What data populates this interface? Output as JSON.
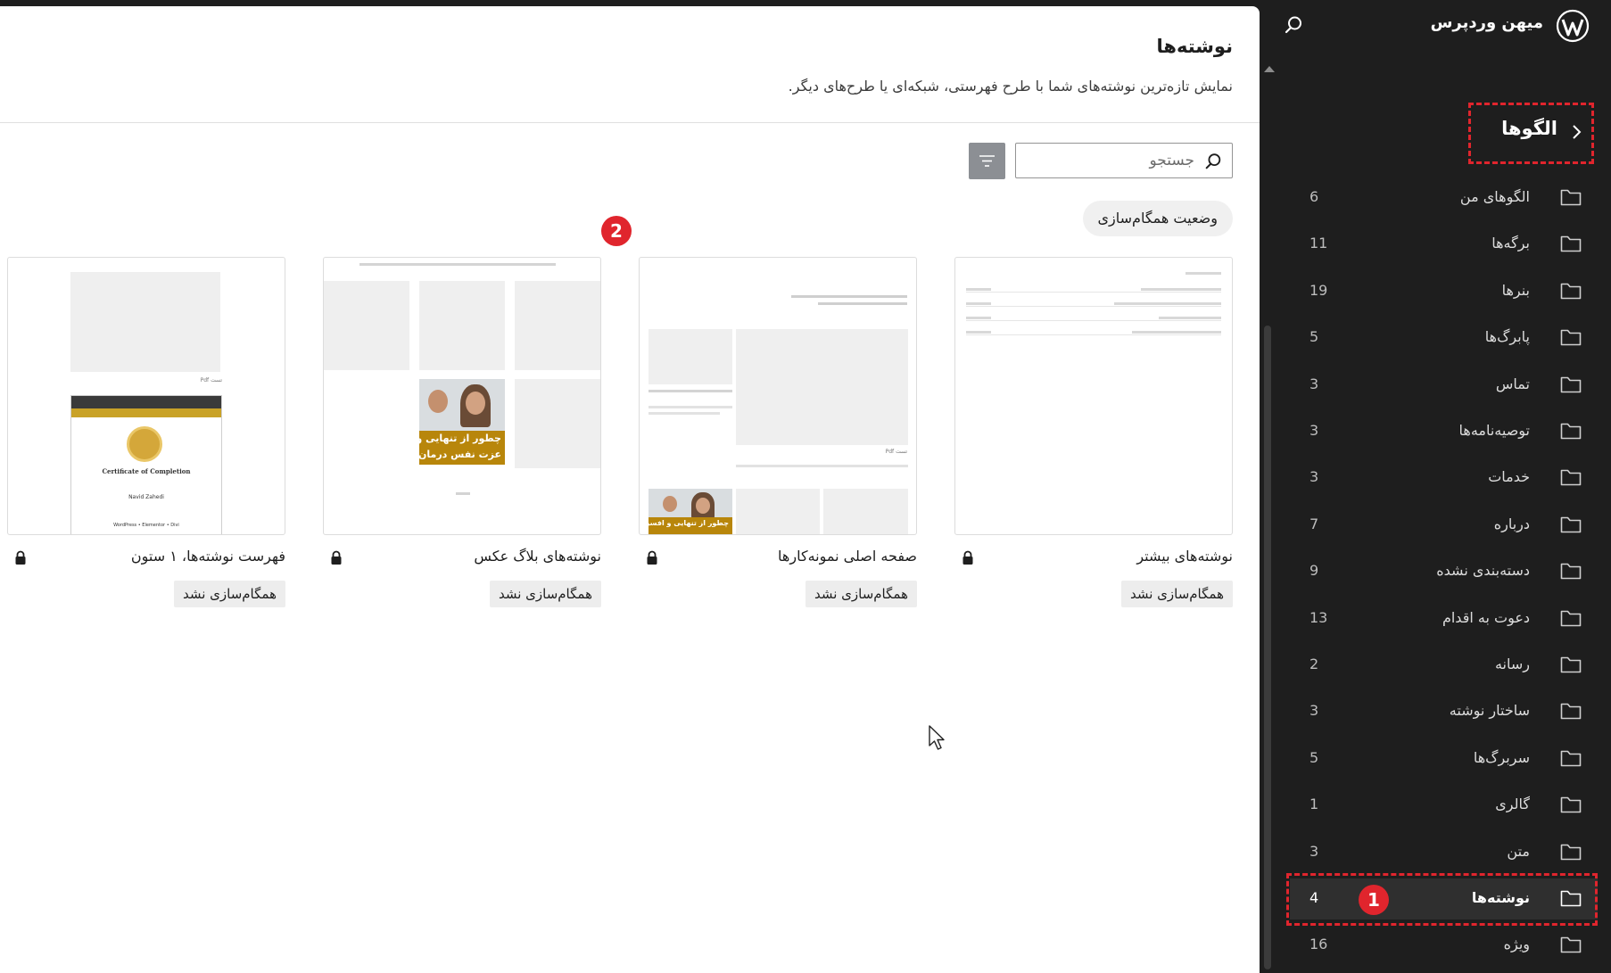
{
  "sidebar": {
    "site_name": "میهن وردپرس",
    "back_label": "الگوها",
    "categories": [
      {
        "name": "الگوهای من",
        "count": "6"
      },
      {
        "name": "برگه‌ها",
        "count": "11"
      },
      {
        "name": "بنرها",
        "count": "19"
      },
      {
        "name": "پابرگ‌ها",
        "count": "5"
      },
      {
        "name": "تماس",
        "count": "3"
      },
      {
        "name": "توصیه‌نامه‌ها",
        "count": "3"
      },
      {
        "name": "خدمات",
        "count": "3"
      },
      {
        "name": "درباره",
        "count": "7"
      },
      {
        "name": "دسته‌بندی نشده",
        "count": "9"
      },
      {
        "name": "دعوت به اقدام",
        "count": "13"
      },
      {
        "name": "رسانه",
        "count": "2"
      },
      {
        "name": "ساختار نوشته",
        "count": "3"
      },
      {
        "name": "سربرگ‌ها",
        "count": "5"
      },
      {
        "name": "گالری",
        "count": "1"
      },
      {
        "name": "متن",
        "count": "3"
      },
      {
        "name": "نوشته‌ها",
        "count": "4"
      },
      {
        "name": "ویژه",
        "count": "16"
      }
    ],
    "active_category": "نوشته‌ها"
  },
  "main": {
    "title": "نوشته‌ها",
    "description": "نمایش تازه‌ترین نوشته‌های شما با طرح فهرستی، شبکه‌ای یا طرح‌های دیگر.",
    "search_placeholder": "جستجو",
    "sync_filter_label": "وضعیت همگام‌سازی",
    "patterns": [
      {
        "title": "نوشته‌های بیشتر",
        "badge": "همگام‌سازی نشد"
      },
      {
        "title": "صفحه اصلی نمونه‌کارها",
        "badge": "همگام‌سازی نشد"
      },
      {
        "title": "نوشته‌های بلاگ عکس",
        "badge": "همگام‌سازی نشد"
      },
      {
        "title": "فهرست نوشته‌ها، ۱ ستون",
        "badge": "همگام‌سازی نشد"
      }
    ]
  },
  "preview_text": {
    "pdf_label": "تست Pdf",
    "banner_text_a": "چطور از تنهایی و افسردگی",
    "banner_text_b": "عزت نفس درمان شو",
    "certificate_title": "Certificate of Completion",
    "certificate_name": "Navid Zahedi",
    "certificate_course": "WordPress • Elementor • Divi"
  },
  "annotations": {
    "step1": "1",
    "step2": "2"
  },
  "colors": {
    "accent_red": "#e0252d",
    "sidebar_bg": "#1e1e1e",
    "filter_button": "#8c8f94"
  }
}
